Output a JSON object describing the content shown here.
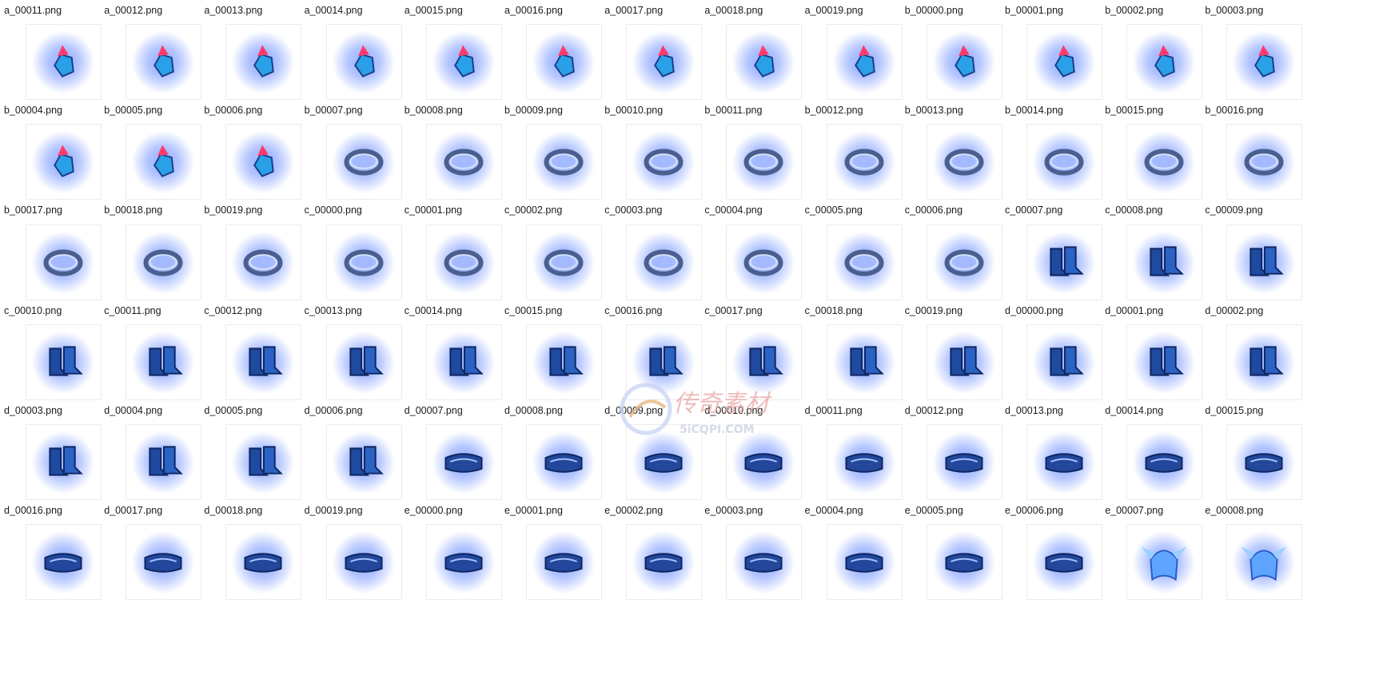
{
  "icon_groups": {
    "a": "blue-orb-icon",
    "b": "blue-gem-red-crystal-icon",
    "c": "spiked-ring-icon",
    "d": "armored-boots-icon",
    "e": "ornate-belt-icon",
    "f": "winged-helmet-icon"
  },
  "colors": {
    "glow": "#3f6cff",
    "metal": "#1d3d86",
    "crystal": "#ff3a6a",
    "label": "#1a1a1a"
  },
  "files": [
    {
      "name": "a_00011.png",
      "icon": "a"
    },
    {
      "name": "a_00012.png",
      "icon": "a"
    },
    {
      "name": "a_00013.png",
      "icon": "a"
    },
    {
      "name": "a_00014.png",
      "icon": "a"
    },
    {
      "name": "a_00015.png",
      "icon": "a"
    },
    {
      "name": "a_00016.png",
      "icon": "a"
    },
    {
      "name": "a_00017.png",
      "icon": "a"
    },
    {
      "name": "a_00018.png",
      "icon": "a"
    },
    {
      "name": "a_00019.png",
      "icon": "a"
    },
    {
      "name": "b_00000.png",
      "icon": "b"
    },
    {
      "name": "b_00001.png",
      "icon": "b"
    },
    {
      "name": "b_00002.png",
      "icon": "b"
    },
    {
      "name": "b_00003.png",
      "icon": "b"
    },
    {
      "name": "b_00004.png",
      "icon": "b"
    },
    {
      "name": "b_00005.png",
      "icon": "b"
    },
    {
      "name": "b_00006.png",
      "icon": "b"
    },
    {
      "name": "b_00007.png",
      "icon": "b"
    },
    {
      "name": "b_00008.png",
      "icon": "b"
    },
    {
      "name": "b_00009.png",
      "icon": "b"
    },
    {
      "name": "b_00010.png",
      "icon": "b"
    },
    {
      "name": "b_00011.png",
      "icon": "b"
    },
    {
      "name": "b_00012.png",
      "icon": "b"
    },
    {
      "name": "b_00013.png",
      "icon": "b"
    },
    {
      "name": "b_00014.png",
      "icon": "b"
    },
    {
      "name": "b_00015.png",
      "icon": "b"
    },
    {
      "name": "b_00016.png",
      "icon": "b"
    },
    {
      "name": "b_00017.png",
      "icon": "b"
    },
    {
      "name": "b_00018.png",
      "icon": "b"
    },
    {
      "name": "b_00019.png",
      "icon": "b"
    },
    {
      "name": "c_00000.png",
      "icon": "c"
    },
    {
      "name": "c_00001.png",
      "icon": "c"
    },
    {
      "name": "c_00002.png",
      "icon": "c"
    },
    {
      "name": "c_00003.png",
      "icon": "c"
    },
    {
      "name": "c_00004.png",
      "icon": "c"
    },
    {
      "name": "c_00005.png",
      "icon": "c"
    },
    {
      "name": "c_00006.png",
      "icon": "c"
    },
    {
      "name": "c_00007.png",
      "icon": "c"
    },
    {
      "name": "c_00008.png",
      "icon": "c"
    },
    {
      "name": "c_00009.png",
      "icon": "c"
    },
    {
      "name": "c_00010.png",
      "icon": "c"
    },
    {
      "name": "c_00011.png",
      "icon": "c"
    },
    {
      "name": "c_00012.png",
      "icon": "c"
    },
    {
      "name": "c_00013.png",
      "icon": "c"
    },
    {
      "name": "c_00014.png",
      "icon": "c"
    },
    {
      "name": "c_00015.png",
      "icon": "c"
    },
    {
      "name": "c_00016.png",
      "icon": "c"
    },
    {
      "name": "c_00017.png",
      "icon": "c"
    },
    {
      "name": "c_00018.png",
      "icon": "c"
    },
    {
      "name": "c_00019.png",
      "icon": "c"
    },
    {
      "name": "d_00000.png",
      "icon": "d"
    },
    {
      "name": "d_00001.png",
      "icon": "d"
    },
    {
      "name": "d_00002.png",
      "icon": "d"
    },
    {
      "name": "d_00003.png",
      "icon": "d"
    },
    {
      "name": "d_00004.png",
      "icon": "d"
    },
    {
      "name": "d_00005.png",
      "icon": "d"
    },
    {
      "name": "d_00006.png",
      "icon": "d"
    },
    {
      "name": "d_00007.png",
      "icon": "d"
    },
    {
      "name": "d_00008.png",
      "icon": "d"
    },
    {
      "name": "d_00009.png",
      "icon": "d"
    },
    {
      "name": "d_00010.png",
      "icon": "d"
    },
    {
      "name": "d_00011.png",
      "icon": "d"
    },
    {
      "name": "d_00012.png",
      "icon": "d"
    },
    {
      "name": "d_00013.png",
      "icon": "d"
    },
    {
      "name": "d_00014.png",
      "icon": "d"
    },
    {
      "name": "d_00015.png",
      "icon": "d"
    },
    {
      "name": "d_00016.png",
      "icon": "d"
    },
    {
      "name": "d_00017.png",
      "icon": "d"
    },
    {
      "name": "d_00018.png",
      "icon": "d"
    },
    {
      "name": "d_00019.png",
      "icon": "d"
    },
    {
      "name": "e_00000.png",
      "icon": "e"
    },
    {
      "name": "e_00001.png",
      "icon": "e"
    },
    {
      "name": "e_00002.png",
      "icon": "e"
    },
    {
      "name": "e_00003.png",
      "icon": "e"
    },
    {
      "name": "e_00004.png",
      "icon": "e"
    },
    {
      "name": "e_00005.png",
      "icon": "e"
    },
    {
      "name": "e_00006.png",
      "icon": "e"
    },
    {
      "name": "e_00007.png",
      "icon": "e"
    },
    {
      "name": "e_00008.png",
      "icon": "e"
    },
    {
      "name": "",
      "icon": "e"
    },
    {
      "name": "",
      "icon": "e"
    },
    {
      "name": "",
      "icon": "e"
    },
    {
      "name": "",
      "icon": "e"
    },
    {
      "name": "",
      "icon": "e"
    },
    {
      "name": "",
      "icon": "e"
    },
    {
      "name": "",
      "icon": "e"
    },
    {
      "name": "",
      "icon": "e"
    },
    {
      "name": "",
      "icon": "e"
    },
    {
      "name": "",
      "icon": "e"
    },
    {
      "name": "",
      "icon": "e"
    },
    {
      "name": "",
      "icon": "f"
    },
    {
      "name": "",
      "icon": "f"
    }
  ],
  "watermark": {
    "text": "传奇素材",
    "sub": "5iCQPI.COM"
  }
}
